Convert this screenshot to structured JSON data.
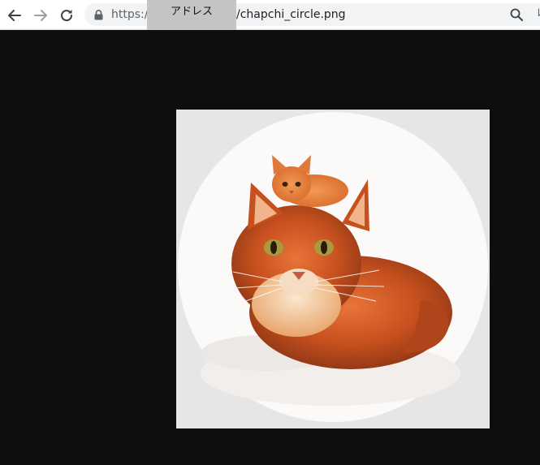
{
  "browser": {
    "url_prefix": "https://",
    "url_suffix": "/chapchi_circle.png",
    "tooltip": "アドレス",
    "icons": {
      "back": "arrow-left-icon",
      "forward": "arrow-right-icon",
      "reload": "reload-icon",
      "lock": "lock-icon",
      "zoom": "zoom-icon"
    }
  },
  "image": {
    "subject": "orange-cat-with-kitten-on-head",
    "frame_color": "#e6e6e6",
    "circle_color": "#fbfaf9"
  }
}
